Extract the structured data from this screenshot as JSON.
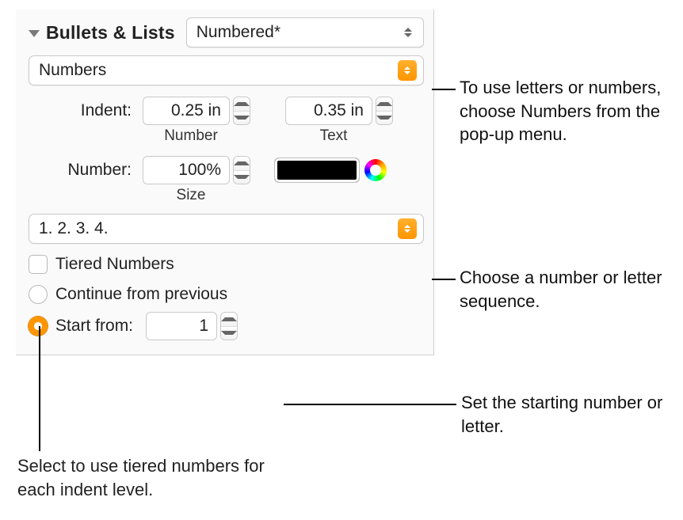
{
  "header": {
    "title": "Bullets & Lists",
    "style_selected": "Numbered*"
  },
  "bullet_type": "Numbers",
  "indent": {
    "label": "Indent:",
    "number_value": "0.25 in",
    "number_sublabel": "Number",
    "text_value": "0.35 in",
    "text_sublabel": "Text"
  },
  "number": {
    "label": "Number:",
    "size_value": "100%",
    "size_sublabel": "Size",
    "color": "#000000"
  },
  "sequence": "1. 2. 3. 4.",
  "tiered_label": "Tiered Numbers",
  "tiered_checked": false,
  "continue_label": "Continue from previous",
  "start_from_label": "Start from:",
  "start_from_value": "1",
  "start_from_selected": true,
  "callouts": {
    "type": "To use letters or numbers, choose Numbers from the pop-up menu.",
    "sequence": "Choose a number or letter sequence.",
    "start": "Set the starting number or letter.",
    "tiered": "Select to use tiered numbers for each indent level."
  }
}
